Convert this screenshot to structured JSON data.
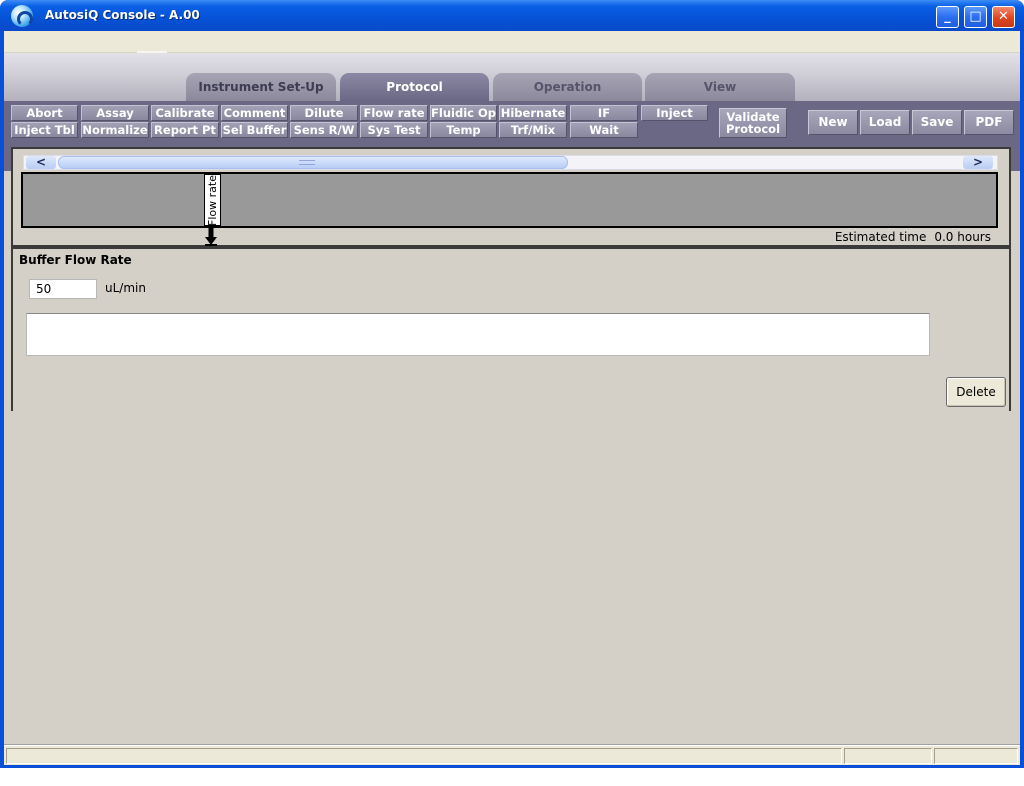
{
  "window": {
    "title": "AutosiQ Console - A.00",
    "controls": {
      "minimize": "_",
      "maximize": "□",
      "close": "✕"
    }
  },
  "tabs": [
    {
      "label": "Instrument Set-Up",
      "state": "inactive"
    },
    {
      "label": "Protocol",
      "state": "active"
    },
    {
      "label": "Operation",
      "state": "inactive"
    },
    {
      "label": "View",
      "state": "inactive"
    }
  ],
  "toolbar": {
    "row1": [
      "Abort",
      "Assay",
      "Calibrate",
      "Comment",
      "Dilute",
      "Flow rate",
      "Fluidic Op",
      "Hibernate",
      "IF",
      "Inject"
    ],
    "row2": [
      "Inject Tbl",
      "Normalize",
      "Report Pt",
      "Sel Buffer",
      "Sens R/W",
      "Sys Test",
      "Temp",
      "Trf/Mix",
      "Wait"
    ],
    "validate": {
      "line1": "Validate",
      "line2": "Protocol"
    },
    "file": [
      "New",
      "Load",
      "Save",
      "PDF"
    ]
  },
  "timeline": {
    "scroll_left": "<",
    "scroll_right": ">",
    "steps": [
      {
        "label": "Flow rate"
      }
    ],
    "estimated_label": "Estimated time",
    "estimated_value": "0.0 hours"
  },
  "step_editor": {
    "title": "Buffer Flow Rate",
    "rate_value": "50",
    "units": "uL/min",
    "description": "",
    "delete_label": "Delete"
  },
  "colors": {
    "titlebar": "#0552d6",
    "toolbar_bg": "#6a6885",
    "active_tab": "#6a6885",
    "client_bg": "#d4d0c8",
    "track": "#999999"
  }
}
